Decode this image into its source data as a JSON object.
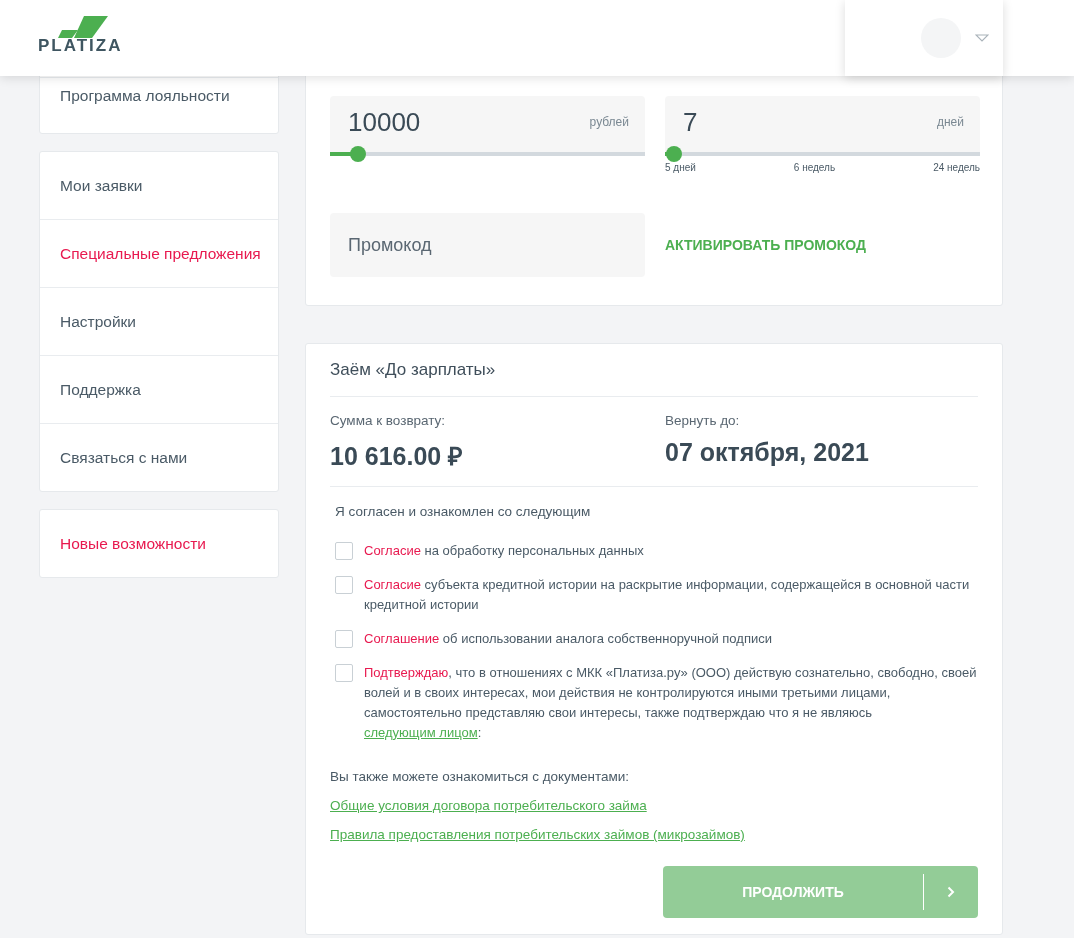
{
  "header": {
    "logo_text": "PLATIZA"
  },
  "sidebar": {
    "groups": [
      {
        "items": [
          {
            "label": "Программа лояльности",
            "accent": false
          }
        ]
      },
      {
        "items": [
          {
            "label": "Мои заявки",
            "accent": false
          },
          {
            "label": "Специальные предложения",
            "accent": true
          },
          {
            "label": "Настройки",
            "accent": false
          },
          {
            "label": "Поддержка",
            "accent": false
          },
          {
            "label": "Связаться с нами",
            "accent": false
          }
        ]
      },
      {
        "items": [
          {
            "label": "Новые возможности",
            "accent": true
          }
        ]
      }
    ]
  },
  "amount": {
    "value": "10000",
    "unit": "рублей",
    "level": 0.09
  },
  "term": {
    "value": "7",
    "unit": "дней",
    "level": 0.03,
    "ticks": [
      "5 дней",
      "6 недель",
      "24 недель"
    ]
  },
  "promo": {
    "placeholder": "Промокод",
    "action": "АКТИВИРОВАТЬ ПРОМОКОД"
  },
  "loan": {
    "title": "Заём «До зарплаты»",
    "repay_label": "Сумма к возврату:",
    "repay_value": "10 616.00 ₽",
    "due_label": "Вернуть до:",
    "due_value": "07 октября, 2021"
  },
  "agree_title": "Я согласен и ознакомлен со следующим",
  "consents": [
    {
      "checked": false,
      "lead": "Согласие",
      "text": " на обработку персональных данных"
    },
    {
      "checked": false,
      "lead": "Согласие",
      "text": " субъекта кредитной истории на раскрытие информации, содержащейся в основной части кредитной истории"
    },
    {
      "checked": false,
      "lead": "Соглашение",
      "text": " об использовании аналога собственноручной подписи"
    },
    {
      "checked": false,
      "lead": "Подтверждаю",
      "text": ", что в отношениях с МКК «Платиза.ру» (ООО) действую сознательно, свободно, своей волей и в своих интересах, мои действия не контролируются иными третьими лицами, самостоятельно представляю свои интересы, также подтверждаю что я не являюсь ",
      "tail_link": "следующим лицом",
      "tail": ":"
    }
  ],
  "docs_title": "Вы также можете ознакомиться с документами:",
  "docs": [
    "Общие условия договора потребительского займа",
    "Правила предоставления потребительских займов (микрозаймов)"
  ],
  "continue": {
    "label": "ПРОДОЛЖИТЬ",
    "disabled": true
  }
}
